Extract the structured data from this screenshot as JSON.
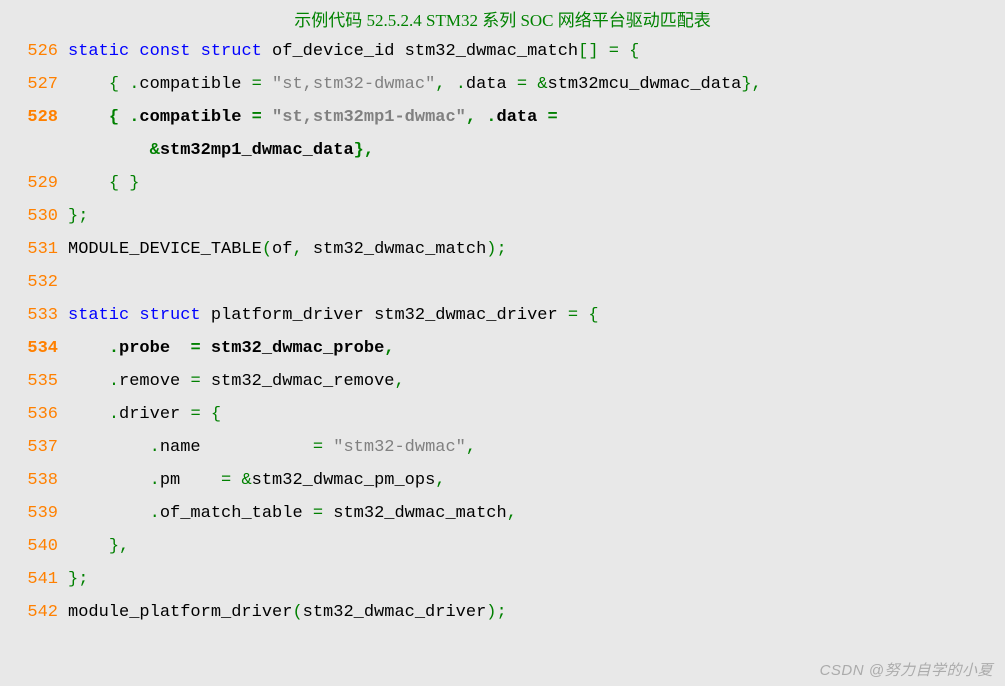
{
  "title": "示例代码 52.5.2.4 STM32 系列 SOC 网络平台驱动匹配表",
  "watermark": "CSDN @努力自学的小夏",
  "lines": [
    {
      "num": "526",
      "bold": false,
      "indent": "",
      "tokens": [
        {
          "t": "static",
          "c": "kw"
        },
        {
          "t": " ",
          "c": "id"
        },
        {
          "t": "const",
          "c": "kw"
        },
        {
          "t": " ",
          "c": "id"
        },
        {
          "t": "struct",
          "c": "kw"
        },
        {
          "t": " of_device_id stm32_dwmac_match",
          "c": "id"
        },
        {
          "t": "[]",
          "c": "punc"
        },
        {
          "t": " ",
          "c": "id"
        },
        {
          "t": "=",
          "c": "punc"
        },
        {
          "t": " ",
          "c": "id"
        },
        {
          "t": "{",
          "c": "punc"
        }
      ]
    },
    {
      "num": "527",
      "bold": false,
      "indent": "    ",
      "tokens": [
        {
          "t": "{",
          "c": "punc"
        },
        {
          "t": " ",
          "c": "id"
        },
        {
          "t": ".",
          "c": "punc"
        },
        {
          "t": "compatible ",
          "c": "id"
        },
        {
          "t": "=",
          "c": "punc"
        },
        {
          "t": " ",
          "c": "id"
        },
        {
          "t": "\"st,stm32-dwmac\"",
          "c": "str"
        },
        {
          "t": ",",
          "c": "punc"
        },
        {
          "t": " ",
          "c": "id"
        },
        {
          "t": ".",
          "c": "punc"
        },
        {
          "t": "data ",
          "c": "id"
        },
        {
          "t": "=",
          "c": "punc"
        },
        {
          "t": " ",
          "c": "id"
        },
        {
          "t": "&",
          "c": "punc"
        },
        {
          "t": "stm32mcu_dwmac_data",
          "c": "id"
        },
        {
          "t": "},",
          "c": "punc"
        }
      ]
    },
    {
      "num": "528",
      "bold": true,
      "indent": "    ",
      "tokens": [
        {
          "t": "{",
          "c": "punc"
        },
        {
          "t": " ",
          "c": "id"
        },
        {
          "t": ".",
          "c": "punc"
        },
        {
          "t": "compatible ",
          "c": "id"
        },
        {
          "t": "=",
          "c": "punc"
        },
        {
          "t": " ",
          "c": "id"
        },
        {
          "t": "\"st,stm32mp1-dwmac\"",
          "c": "str"
        },
        {
          "t": ",",
          "c": "punc"
        },
        {
          "t": " ",
          "c": "id"
        },
        {
          "t": ".",
          "c": "punc"
        },
        {
          "t": "data ",
          "c": "id"
        },
        {
          "t": "=",
          "c": "punc"
        }
      ]
    },
    {
      "num": "",
      "bold": true,
      "indent": "        ",
      "tokens": [
        {
          "t": "&",
          "c": "punc"
        },
        {
          "t": "stm32mp1_dwmac_data",
          "c": "id"
        },
        {
          "t": "},",
          "c": "punc"
        }
      ]
    },
    {
      "num": "529",
      "bold": false,
      "indent": "    ",
      "tokens": [
        {
          "t": "{",
          "c": "punc"
        },
        {
          "t": " ",
          "c": "id"
        },
        {
          "t": "}",
          "c": "punc"
        }
      ]
    },
    {
      "num": "530",
      "bold": false,
      "indent": "",
      "tokens": [
        {
          "t": "};",
          "c": "punc"
        }
      ]
    },
    {
      "num": "531",
      "bold": false,
      "indent": "",
      "tokens": [
        {
          "t": "MODULE_DEVICE_TABLE",
          "c": "id"
        },
        {
          "t": "(",
          "c": "punc"
        },
        {
          "t": "of",
          "c": "id"
        },
        {
          "t": ",",
          "c": "punc"
        },
        {
          "t": " stm32_dwmac_match",
          "c": "id"
        },
        {
          "t": ");",
          "c": "punc"
        }
      ]
    },
    {
      "num": "532",
      "bold": false,
      "indent": "",
      "tokens": []
    },
    {
      "num": "533",
      "bold": false,
      "indent": "",
      "tokens": [
        {
          "t": "static",
          "c": "kw"
        },
        {
          "t": " ",
          "c": "id"
        },
        {
          "t": "struct",
          "c": "kw"
        },
        {
          "t": " platform_driver stm32_dwmac_driver ",
          "c": "id"
        },
        {
          "t": "=",
          "c": "punc"
        },
        {
          "t": " ",
          "c": "id"
        },
        {
          "t": "{",
          "c": "punc"
        }
      ]
    },
    {
      "num": "534",
      "bold": true,
      "indent": "    ",
      "tokens": [
        {
          "t": ".",
          "c": "punc"
        },
        {
          "t": "probe  ",
          "c": "id"
        },
        {
          "t": "=",
          "c": "punc"
        },
        {
          "t": " stm32_dwmac_probe",
          "c": "id"
        },
        {
          "t": ",",
          "c": "punc"
        }
      ]
    },
    {
      "num": "535",
      "bold": false,
      "indent": "    ",
      "tokens": [
        {
          "t": ".",
          "c": "punc"
        },
        {
          "t": "remove ",
          "c": "id"
        },
        {
          "t": "=",
          "c": "punc"
        },
        {
          "t": " stm32_dwmac_remove",
          "c": "id"
        },
        {
          "t": ",",
          "c": "punc"
        }
      ]
    },
    {
      "num": "536",
      "bold": false,
      "indent": "    ",
      "tokens": [
        {
          "t": ".",
          "c": "punc"
        },
        {
          "t": "driver ",
          "c": "id"
        },
        {
          "t": "=",
          "c": "punc"
        },
        {
          "t": " ",
          "c": "id"
        },
        {
          "t": "{",
          "c": "punc"
        }
      ]
    },
    {
      "num": "537",
      "bold": false,
      "indent": "        ",
      "tokens": [
        {
          "t": ".",
          "c": "punc"
        },
        {
          "t": "name           ",
          "c": "id"
        },
        {
          "t": "=",
          "c": "punc"
        },
        {
          "t": " ",
          "c": "id"
        },
        {
          "t": "\"stm32-dwmac\"",
          "c": "str"
        },
        {
          "t": ",",
          "c": "punc"
        }
      ]
    },
    {
      "num": "538",
      "bold": false,
      "indent": "        ",
      "tokens": [
        {
          "t": ".",
          "c": "punc"
        },
        {
          "t": "pm    ",
          "c": "id"
        },
        {
          "t": "=",
          "c": "punc"
        },
        {
          "t": " ",
          "c": "id"
        },
        {
          "t": "&",
          "c": "punc"
        },
        {
          "t": "stm32_dwmac_pm_ops",
          "c": "id"
        },
        {
          "t": ",",
          "c": "punc"
        }
      ]
    },
    {
      "num": "539",
      "bold": false,
      "indent": "        ",
      "tokens": [
        {
          "t": ".",
          "c": "punc"
        },
        {
          "t": "of_match_table ",
          "c": "id"
        },
        {
          "t": "=",
          "c": "punc"
        },
        {
          "t": " stm32_dwmac_match",
          "c": "id"
        },
        {
          "t": ",",
          "c": "punc"
        }
      ]
    },
    {
      "num": "540",
      "bold": false,
      "indent": "    ",
      "tokens": [
        {
          "t": "},",
          "c": "punc"
        }
      ]
    },
    {
      "num": "541",
      "bold": false,
      "indent": "",
      "tokens": [
        {
          "t": "};",
          "c": "punc"
        }
      ]
    },
    {
      "num": "542",
      "bold": false,
      "indent": "",
      "tokens": [
        {
          "t": "module_platform_driver",
          "c": "id"
        },
        {
          "t": "(",
          "c": "punc"
        },
        {
          "t": "stm32_dwmac_driver",
          "c": "id"
        },
        {
          "t": ");",
          "c": "punc"
        }
      ]
    }
  ]
}
